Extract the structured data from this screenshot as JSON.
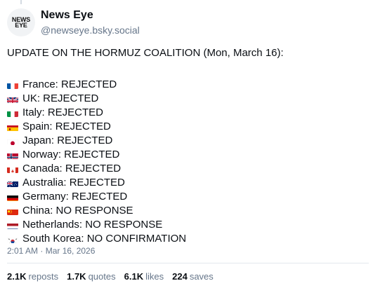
{
  "author": {
    "name": "News Eye",
    "handle": "@newseye.bsky.social",
    "avatar_lines": [
      "NEWS",
      "EYE"
    ]
  },
  "post": {
    "intro": "UPDATE ON THE HORMUZ COALITION (Mon, March 16):",
    "items": [
      {
        "flag": "fr",
        "text": "France: REJECTED"
      },
      {
        "flag": "gb",
        "text": "UK: REJECTED"
      },
      {
        "flag": "it",
        "text": "Italy: REJECTED"
      },
      {
        "flag": "es",
        "text": "Spain: REJECTED"
      },
      {
        "flag": "jp",
        "text": "Japan: REJECTED"
      },
      {
        "flag": "no",
        "text": "Norway: REJECTED"
      },
      {
        "flag": "ca",
        "text": "Canada: REJECTED"
      },
      {
        "flag": "au",
        "text": "Australia: REJECTED"
      },
      {
        "flag": "de",
        "text": "Germany: REJECTED"
      },
      {
        "flag": "cn",
        "text": "China: NO RESPONSE"
      },
      {
        "flag": "nl",
        "text": "Netherlands: NO RESPONSE"
      },
      {
        "flag": "kr",
        "text": "South Korea: NO CONFIRMATION"
      }
    ],
    "timestamp": "2:01 AM · Mar 16, 2026"
  },
  "stats": {
    "reposts_count": "2.1K",
    "reposts_label": "reposts",
    "quotes_count": "1.7K",
    "quotes_label": "quotes",
    "likes_count": "6.1K",
    "likes_label": "likes",
    "saves_count": "224",
    "saves_label": "saves"
  }
}
